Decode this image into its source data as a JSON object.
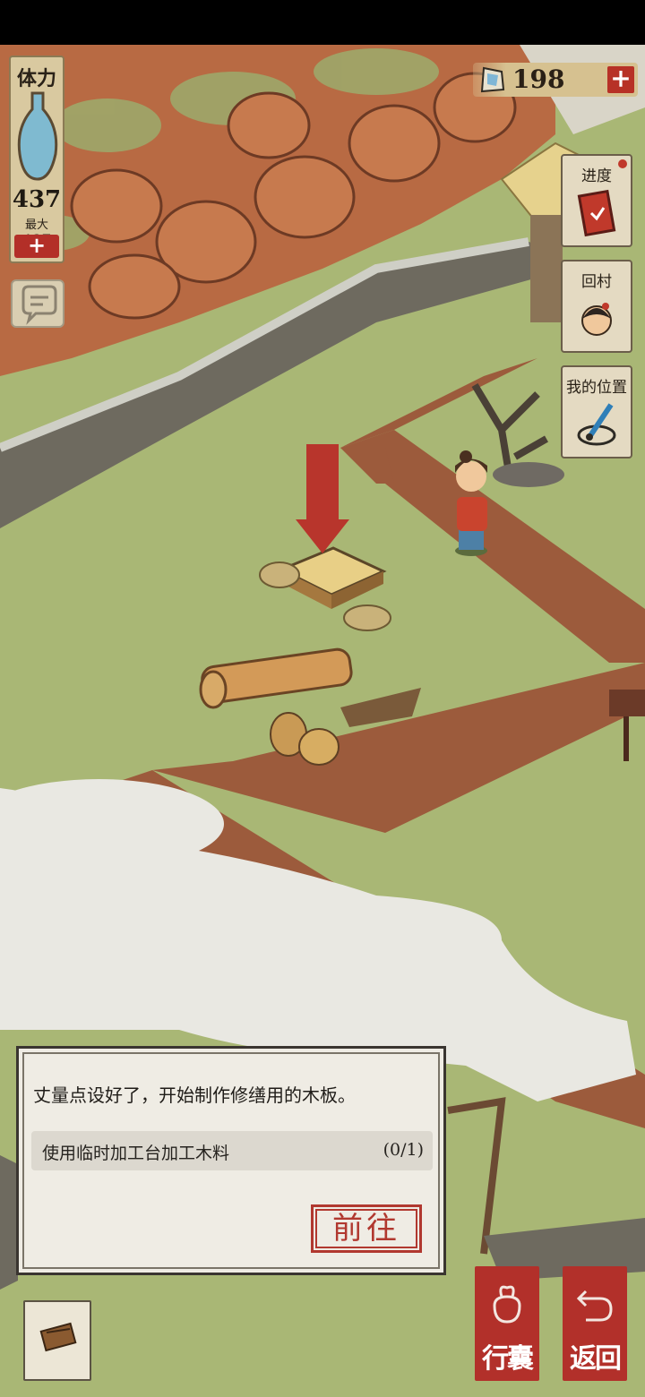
{
  "hud": {
    "stamina": {
      "title": "体力",
      "value": "437",
      "max_label": "最大",
      "max_value": "437",
      "plus": "+"
    },
    "currency": {
      "value": "198",
      "plus": "+"
    },
    "side_menu": [
      {
        "label": "进度",
        "icon": "red-book-icon"
      },
      {
        "label": "回村",
        "icon": "villager-portrait-icon"
      },
      {
        "label": "我的位置",
        "icon": "brush-location-icon"
      }
    ]
  },
  "dialog": {
    "text": "丈量点设好了，开始制作修缮用的木板。",
    "task": {
      "label": "使用临时加工台加工木料",
      "progress": "(0/1)"
    },
    "go_button": "前往"
  },
  "bottom_bar": {
    "bag_label": "行囊",
    "back_label": "返回"
  },
  "colors": {
    "accent_red": "#b2302a",
    "grass": "#a9b775",
    "path": "#9c5b3c",
    "panel": "#d9c9a0"
  }
}
